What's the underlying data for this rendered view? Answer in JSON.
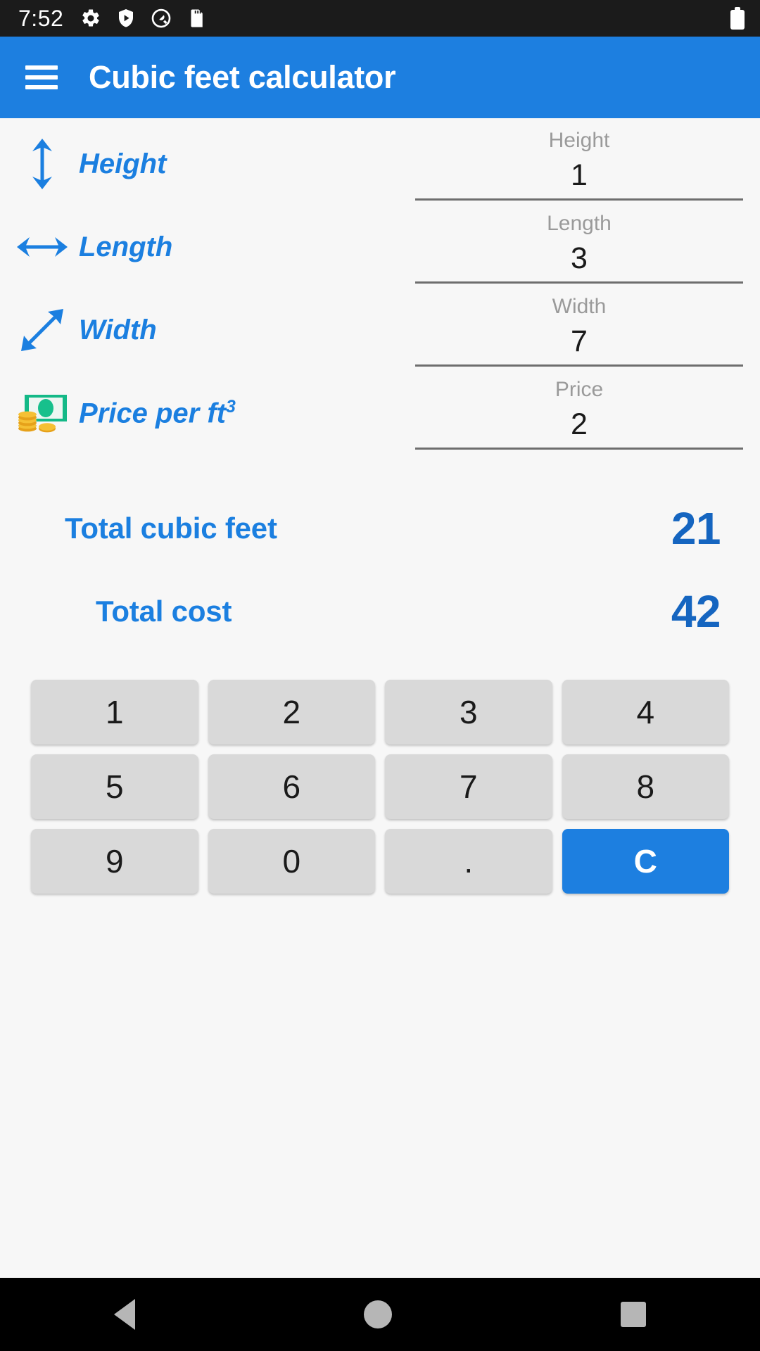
{
  "status_bar": {
    "time": "7:52",
    "icons": [
      "gear-icon",
      "shield-play-icon",
      "quantum-circle-icon",
      "sd-card-icon"
    ],
    "battery": "battery-full-icon"
  },
  "app_bar": {
    "menu_icon": "hamburger-menu-icon",
    "title": "Cubic feet calculator",
    "background_color": "#1d7fe0"
  },
  "inputs": [
    {
      "icon": "vertical-double-arrow-icon",
      "label": "Height",
      "field_label": "Height",
      "value": "1"
    },
    {
      "icon": "horizontal-double-arrow-icon",
      "label": "Length",
      "field_label": "Length",
      "value": "3"
    },
    {
      "icon": "diagonal-double-arrow-icon",
      "label": "Width",
      "field_label": "Width",
      "value": "7"
    },
    {
      "icon": "money-banknote-coins-icon",
      "label": "Price per ft",
      "label_sup": "3",
      "field_label": "Price",
      "value": "2"
    }
  ],
  "totals": [
    {
      "label": "Total cubic feet",
      "value": "21"
    },
    {
      "label": "Total cost",
      "value": "42"
    }
  ],
  "keypad": {
    "rows": [
      [
        "1",
        "2",
        "3",
        "4"
      ],
      [
        "5",
        "6",
        "7",
        "8"
      ],
      [
        "9",
        "0",
        ".",
        "C"
      ]
    ],
    "clear_key": "C",
    "accent_color": "#1d7fe0"
  },
  "nav_bar": {
    "back": "back-triangle-icon",
    "home": "home-circle-icon",
    "recents": "recents-square-icon"
  },
  "colors": {
    "accent": "#1d7fe0",
    "label_blue": "#1b7fe0",
    "value_blue": "#1565c0",
    "background": "#f7f7f7",
    "key_gray": "#d9d9d9"
  }
}
